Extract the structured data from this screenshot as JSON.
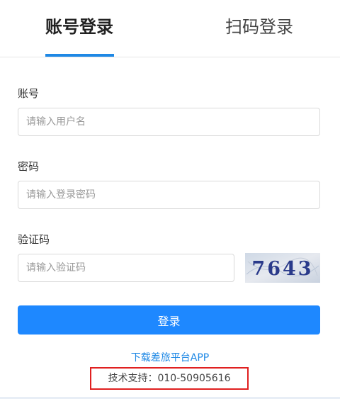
{
  "tabs": [
    {
      "label": "账号登录",
      "active": true
    },
    {
      "label": "扫码登录",
      "active": false
    }
  ],
  "form": {
    "account": {
      "label": "账号",
      "placeholder": "请输入用户名",
      "value": ""
    },
    "password": {
      "label": "密码",
      "placeholder": "请输入登录密码",
      "value": ""
    },
    "captcha": {
      "label": "验证码",
      "placeholder": "请输入验证码",
      "value": "",
      "image_text": "7643"
    }
  },
  "login_button": "登录",
  "download_link": "下载差旅平台APP",
  "support": "技术支持：010-50905616",
  "colors": {
    "accent": "#1e88ff",
    "highlight_border": "#e02020"
  }
}
